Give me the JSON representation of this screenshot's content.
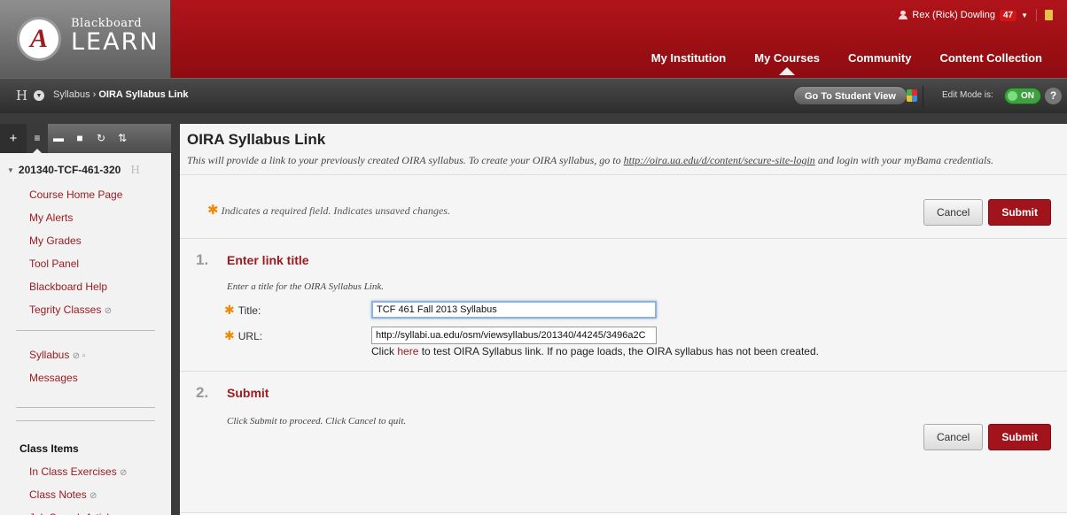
{
  "header": {
    "logo_letter": "A",
    "logo_brand": "Blackboard",
    "logo_product": "LEARN",
    "user_name": "Rex (Rick) Dowling",
    "notification_count": "47",
    "nav": [
      {
        "label": "My Institution",
        "active": false
      },
      {
        "label": "My Courses",
        "active": true
      },
      {
        "label": "Community",
        "active": false
      },
      {
        "label": "Content Collection",
        "active": false
      }
    ]
  },
  "breadcrumb": {
    "home_letter": "H",
    "parent": "Syllabus",
    "separator": "›",
    "current": "OIRA Syllabus Link",
    "student_view_label": "Go To Student View",
    "edit_mode_label": "Edit Mode is:",
    "edit_mode_state": "ON",
    "help_label": "?"
  },
  "sidebar": {
    "course_id": "201340-TCF-461-320",
    "ghost_letter": "H",
    "group1": [
      "Course Home Page",
      "My Alerts",
      "My Grades",
      "Tool Panel",
      "Blackboard Help",
      "Tegrity Classes"
    ],
    "group2": [
      "Syllabus",
      "Messages"
    ],
    "section_heading": "Class Items",
    "group3": [
      "In Class Exercises",
      "Class Notes",
      "Job Search Articles"
    ]
  },
  "page": {
    "title": "OIRA Syllabus Link",
    "description_before": "This will provide a link to your previously created OIRA syllabus. To create your OIRA syllabus, go to ",
    "description_link": "http://oira.ua.edu/d/content/secure-site-login",
    "description_after": " and login with your myBama credentials.",
    "required_note": "Indicates a required field. Indicates unsaved changes.",
    "cancel_label": "Cancel",
    "submit_label": "Submit"
  },
  "step1": {
    "number": "1.",
    "title": "Enter link title",
    "instructions": "Enter a title for the OIRA Syllabus Link.",
    "title_label": "Title:",
    "title_value": "TCF 461 Fall 2013 Syllabus",
    "url_label": "URL:",
    "url_value": "http://syllabi.ua.edu/osm/viewsyllabus/201340/44245/3496a2C",
    "help_before": "Click ",
    "help_link": "here",
    "help_after": " to test OIRA Syllabus link. If no page loads, the OIRA syllabus has not been created."
  },
  "step2": {
    "number": "2.",
    "title": "Submit",
    "instructions": "Click Submit to proceed. Click Cancel to quit."
  },
  "colors": {
    "brand_red": "#9e1b20",
    "required_star": "#f08a00",
    "edit_on_green": "#3ea03e"
  }
}
